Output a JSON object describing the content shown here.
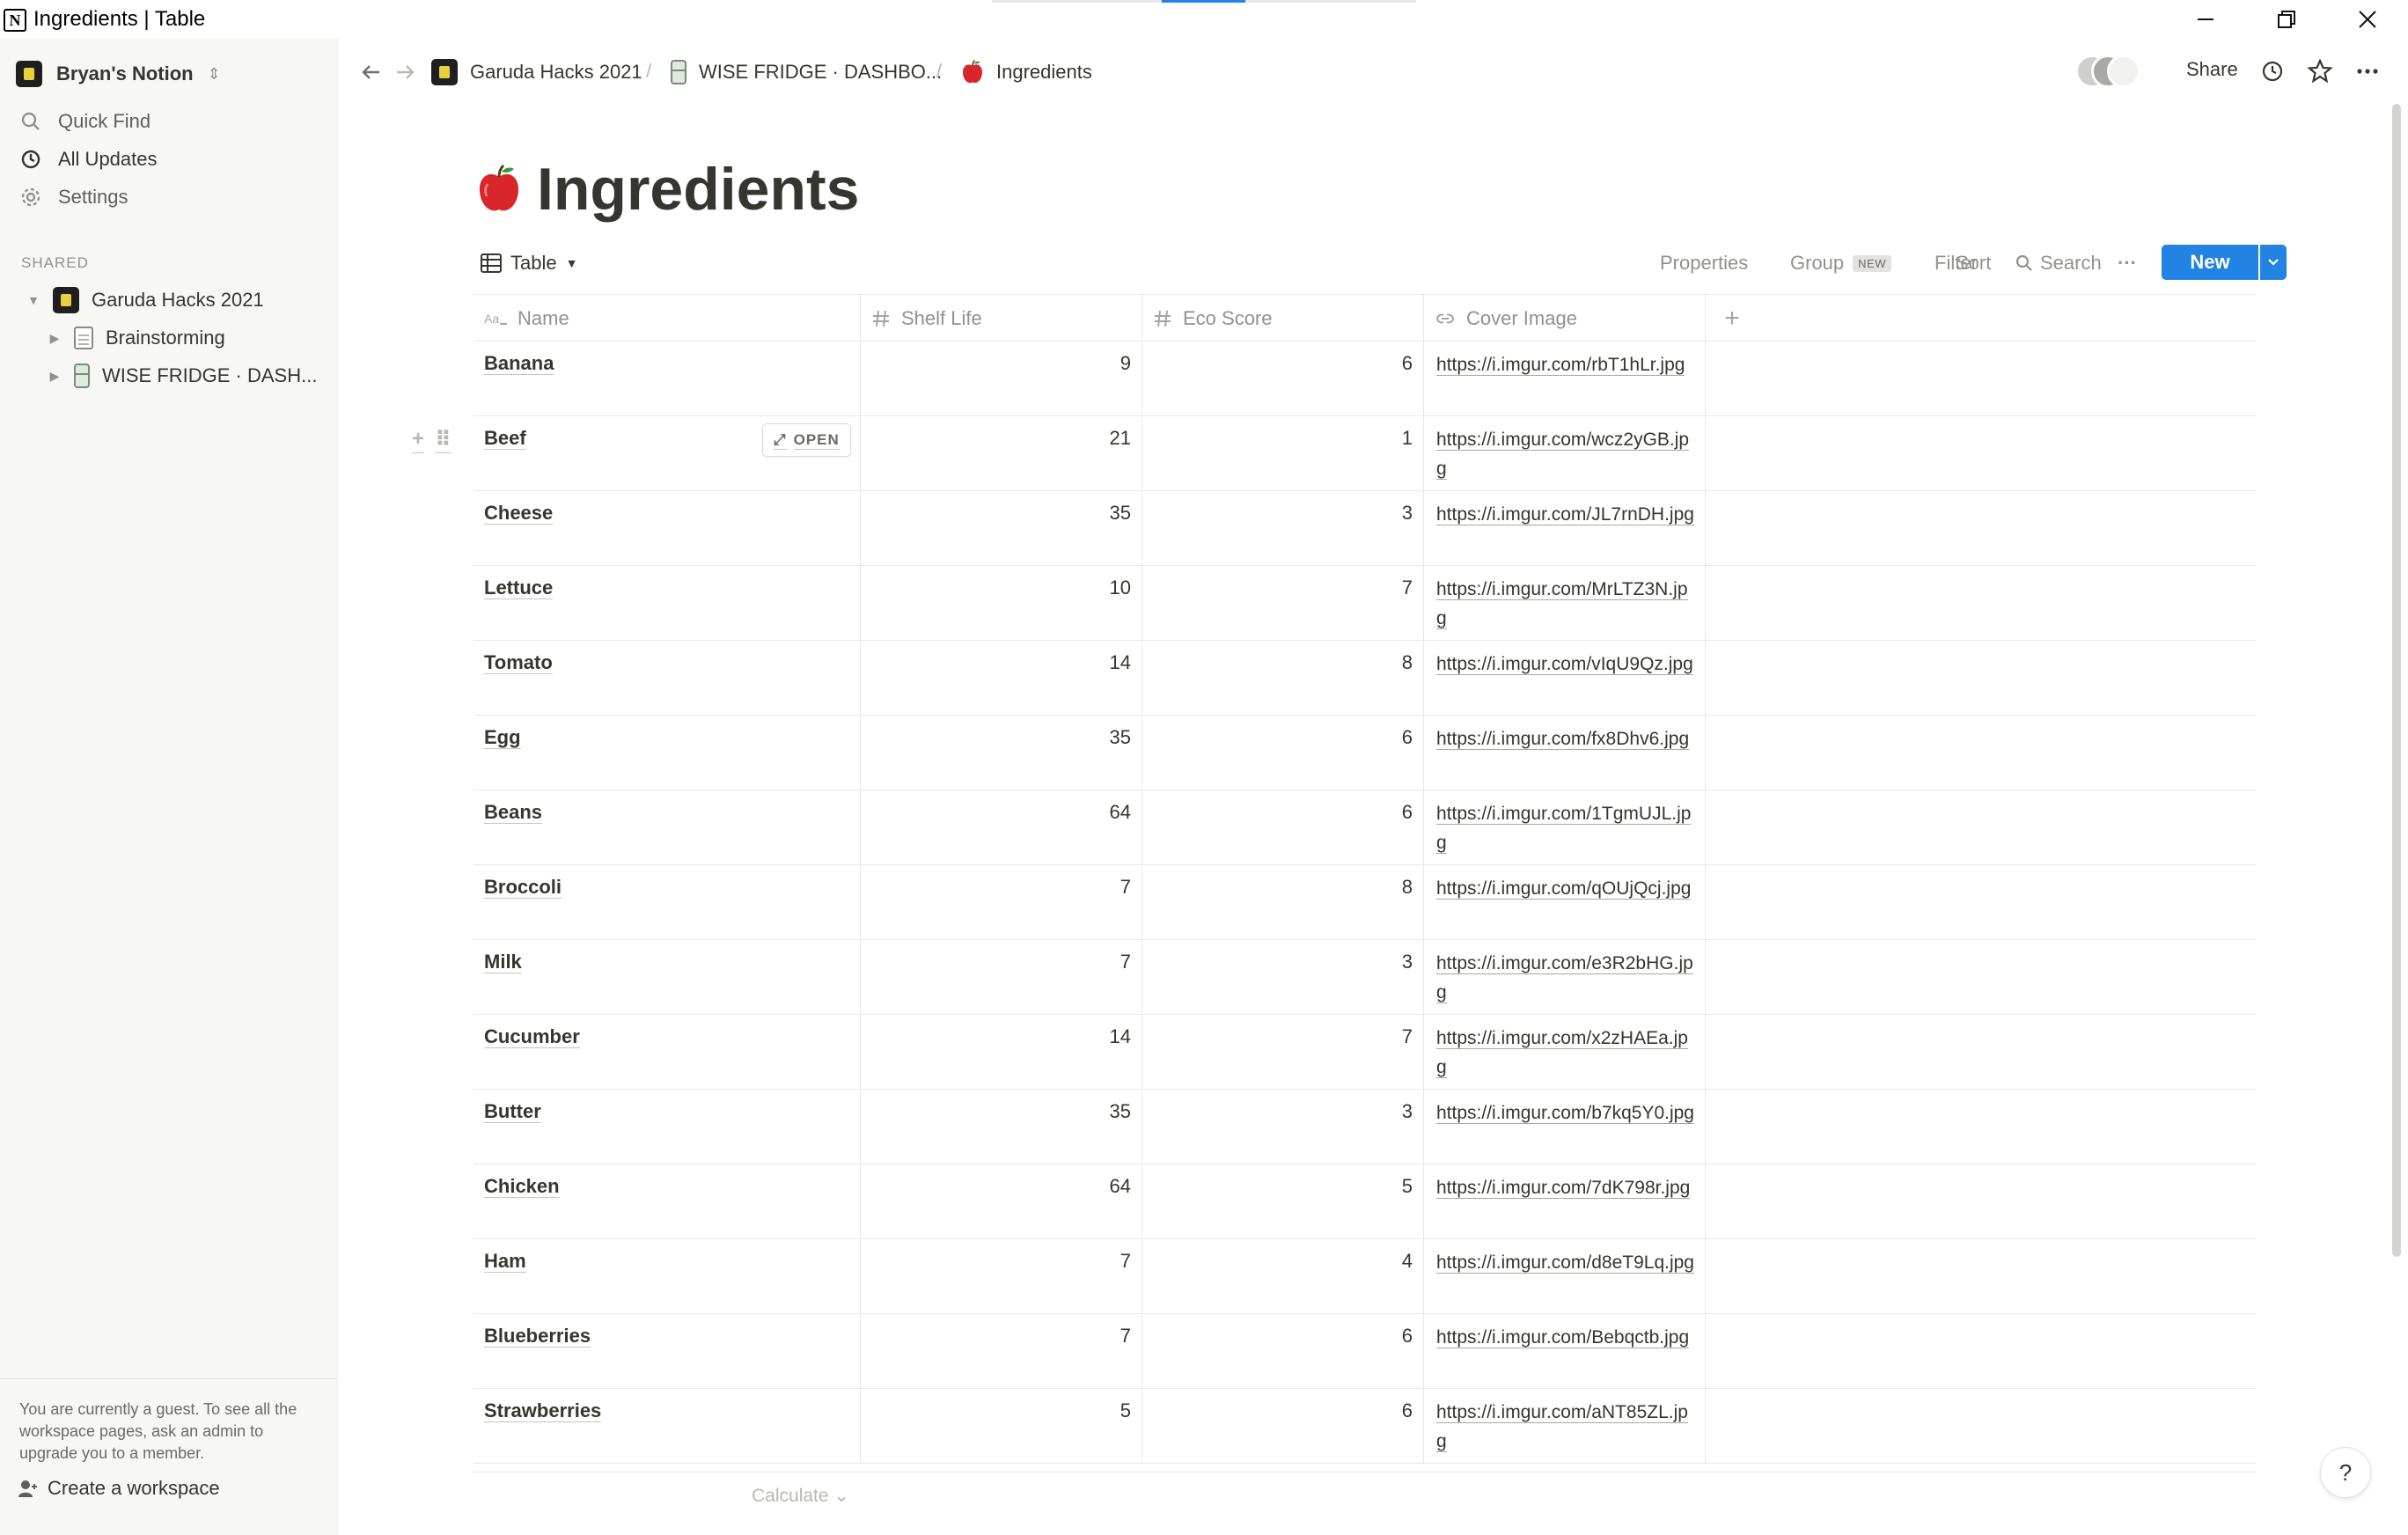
{
  "window": {
    "title": "Ingredients | Table",
    "app_icon_letter": "N"
  },
  "sidebar": {
    "workspace_name": "Bryan's Notion",
    "items": [
      {
        "label": "Quick Find",
        "icon": "search-icon"
      },
      {
        "label": "All Updates",
        "icon": "clock-icon"
      },
      {
        "label": "Settings",
        "icon": "gear-icon"
      }
    ],
    "section_label": "SHARED",
    "tree": [
      {
        "label": "Garuda Hacks 2021",
        "expanded": true
      },
      {
        "label": "Brainstorming",
        "expanded": false
      },
      {
        "label": "WISE FRIDGE · DASH...",
        "expanded": false
      }
    ],
    "guest_note": "You are currently a guest. To see all the workspace pages, ask an admin to upgrade you to a member.",
    "create_workspace": "Create a workspace"
  },
  "topbar": {
    "breadcrumbs": [
      "Garuda Hacks 2021",
      "WISE FRIDGE · DASHBO...",
      "Ingredients"
    ],
    "separator": "/",
    "share_label": "Share"
  },
  "page": {
    "title": "Ingredients",
    "icon": "red-apple-icon"
  },
  "database": {
    "view_label": "Table",
    "actions": {
      "properties": "Properties",
      "group": "Group",
      "group_badge": "NEW",
      "filter": "Filter",
      "sort": "Sort",
      "search": "Search",
      "more": "···",
      "new": "New"
    },
    "columns": [
      "Name",
      "Shelf Life",
      "Eco Score",
      "Cover Image"
    ],
    "add_column": "+",
    "rows": [
      {
        "name": "Banana",
        "shelf_life": "9",
        "eco_score": "6",
        "cover_image": "https://i.imgur.com/rbT1hLr.jpg"
      },
      {
        "name": "Beef",
        "shelf_life": "21",
        "eco_score": "1",
        "cover_image": "https://i.imgur.com/wcz2yGB.jpg"
      },
      {
        "name": "Cheese",
        "shelf_life": "35",
        "eco_score": "3",
        "cover_image": "https://i.imgur.com/JL7rnDH.jpg"
      },
      {
        "name": "Lettuce",
        "shelf_life": "10",
        "eco_score": "7",
        "cover_image": "https://i.imgur.com/MrLTZ3N.jpg"
      },
      {
        "name": "Tomato",
        "shelf_life": "14",
        "eco_score": "8",
        "cover_image": "https://i.imgur.com/vIqU9Qz.jpg"
      },
      {
        "name": "Egg",
        "shelf_life": "35",
        "eco_score": "6",
        "cover_image": "https://i.imgur.com/fx8Dhv6.jpg"
      },
      {
        "name": "Beans",
        "shelf_life": "64",
        "eco_score": "6",
        "cover_image": "https://i.imgur.com/1TgmUJL.jpg"
      },
      {
        "name": "Broccoli",
        "shelf_life": "7",
        "eco_score": "8",
        "cover_image": "https://i.imgur.com/qOUjQcj.jpg"
      },
      {
        "name": "Milk",
        "shelf_life": "7",
        "eco_score": "3",
        "cover_image": "https://i.imgur.com/e3R2bHG.jpg"
      },
      {
        "name": "Cucumber",
        "shelf_life": "14",
        "eco_score": "7",
        "cover_image": "https://i.imgur.com/x2zHAEa.jpg"
      },
      {
        "name": "Butter",
        "shelf_life": "35",
        "eco_score": "3",
        "cover_image": "https://i.imgur.com/b7kq5Y0.jpg"
      },
      {
        "name": "Chicken",
        "shelf_life": "64",
        "eco_score": "5",
        "cover_image": "https://i.imgur.com/7dK798r.jpg"
      },
      {
        "name": "Ham",
        "shelf_life": "7",
        "eco_score": "4",
        "cover_image": "https://i.imgur.com/d8eT9Lq.jpg"
      },
      {
        "name": "Blueberries",
        "shelf_life": "7",
        "eco_score": "6",
        "cover_image": "https://i.imgur.com/Bebqctb.jpg"
      },
      {
        "name": "Strawberries",
        "shelf_life": "5",
        "eco_score": "6",
        "cover_image": "https://i.imgur.com/aNT85ZL.jpg"
      }
    ],
    "open_label": "OPEN",
    "calculate_label": "Calculate"
  },
  "help_label": "?",
  "colors": {
    "accent": "#2383e2",
    "sidebar_bg": "#f7f7f5",
    "text": "#37352f",
    "muted": "#91918e"
  }
}
